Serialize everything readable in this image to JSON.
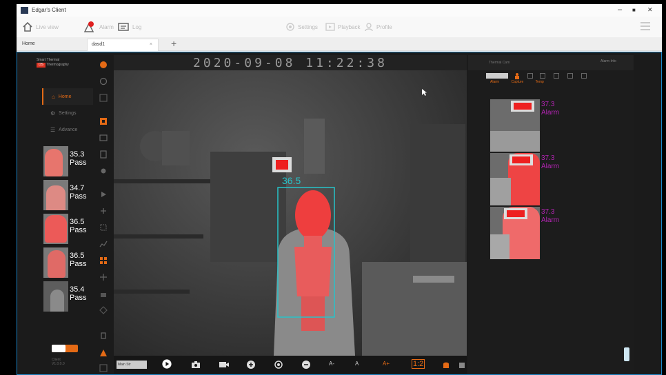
{
  "window": {
    "title": "Edgar's Client",
    "controls": {
      "minimize": "–",
      "maximize": "■",
      "close": "✕"
    }
  },
  "toolbar": {
    "live_view_label": "Live view",
    "alarm_label": "Alarm",
    "log_label": "Log",
    "settings_label": "Settings",
    "playback_label": "Playback",
    "profile_label": "Profile"
  },
  "tabs": [
    {
      "label": "Home"
    },
    {
      "label": "dasd1"
    }
  ],
  "tab_add": "+",
  "tab_close": "×",
  "left_panel": {
    "brand_line1": "Smart Thermal",
    "brand_line2": "Thermography",
    "nav": [
      {
        "icon": "home-icon",
        "label": "Home",
        "active": true
      },
      {
        "icon": "gear-icon",
        "label": "Settings",
        "active": false
      },
      {
        "icon": "sliders-icon",
        "label": "Advance",
        "active": false
      }
    ],
    "captures": [
      {
        "temp": "35.3",
        "status": "Pass"
      },
      {
        "temp": "34.7",
        "status": "Pass"
      },
      {
        "temp": "36.5",
        "status": "Pass"
      },
      {
        "temp": "36.5",
        "status": "Pass"
      },
      {
        "temp": "35.4",
        "status": "Pass"
      }
    ],
    "footer_line1": "Client",
    "footer_line2": "V1.0.0.0"
  },
  "video": {
    "datetime": "2020-09-08 11:22:38",
    "detected_temp": "36.5",
    "box_color": "#27c3c9",
    "highlight_color": "#ee3e3e"
  },
  "controls": {
    "stream_label": "Main Str",
    "font_small": "A-",
    "font_normal": "A",
    "font_large": "A+",
    "ratio_label": "1:2"
  },
  "right_panel": {
    "header": "Thermal Cam",
    "subheader": "Alarm Info",
    "tabs": [
      "Alarm",
      "Capture",
      "Temp"
    ],
    "alarms": [
      {
        "temp": "37.3",
        "status": "Alarm"
      },
      {
        "temp": "37.3",
        "status": "Alarm"
      },
      {
        "temp": "37.3",
        "status": "Alarm"
      }
    ]
  },
  "colors": {
    "accent": "#e46a15",
    "alarm_text": "#b324b3",
    "border": "#1e88c9"
  }
}
